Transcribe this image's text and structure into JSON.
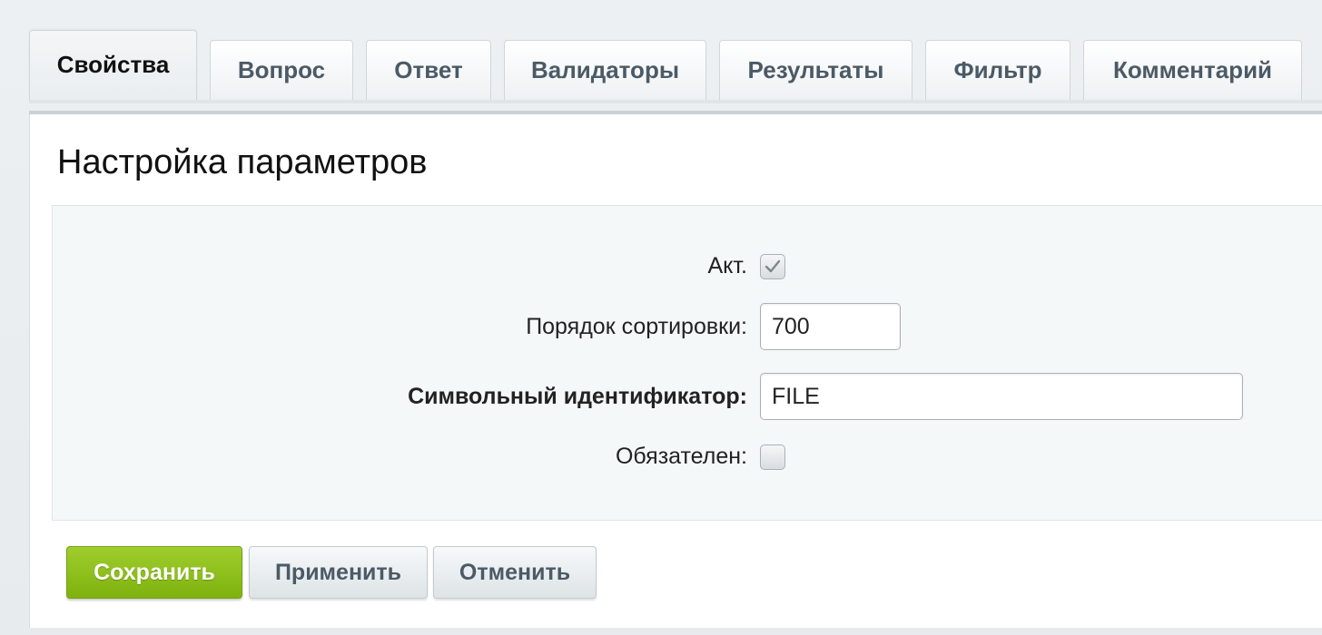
{
  "tabs": [
    {
      "label": "Свойства",
      "active": true
    },
    {
      "label": "Вопрос",
      "active": false
    },
    {
      "label": "Ответ",
      "active": false
    },
    {
      "label": "Валидаторы",
      "active": false
    },
    {
      "label": "Результаты",
      "active": false
    },
    {
      "label": "Фильтр",
      "active": false
    },
    {
      "label": "Комментарий",
      "active": false
    }
  ],
  "page": {
    "title": "Настройка параметров"
  },
  "form": {
    "active": {
      "label": "Акт.",
      "checked": true
    },
    "sort": {
      "label": "Порядок сортировки:",
      "value": "700"
    },
    "code": {
      "label": "Символьный идентификатор:",
      "value": "FILE"
    },
    "required": {
      "label": "Обязателен:",
      "checked": false
    }
  },
  "buttons": {
    "save": "Сохранить",
    "apply": "Применить",
    "cancel": "Отменить"
  },
  "colors": {
    "save_button": "#8cbf1c",
    "panel_background": "#f5f8f9",
    "tab_text": "#4b5a66"
  }
}
